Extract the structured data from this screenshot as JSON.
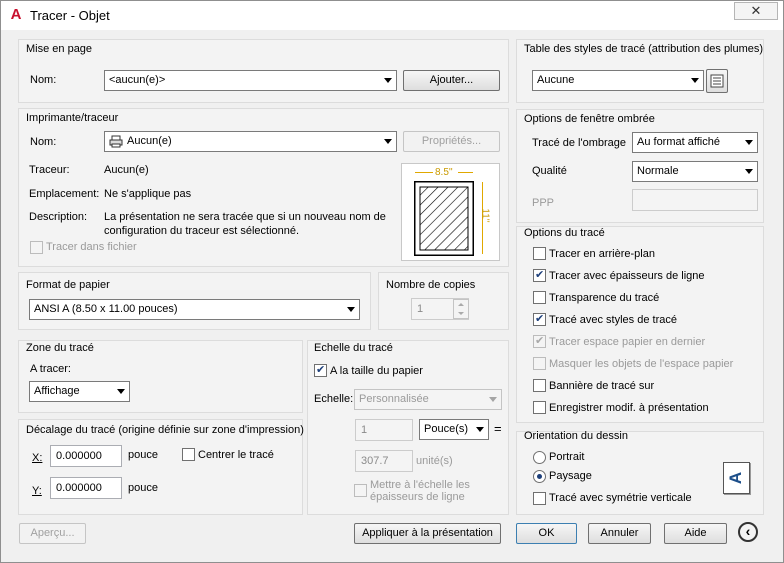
{
  "window": {
    "title": "Tracer - Objet",
    "close": "✕"
  },
  "page_setup": {
    "label": "Mise en page",
    "name_label": "Nom:",
    "name_value": "<aucun(e)>",
    "add_button": "Ajouter..."
  },
  "printer": {
    "label": "Imprimante/traceur",
    "name_label": "Nom:",
    "name_value": "Aucun(e)",
    "properties_button": "Propriétés...",
    "plotter_label": "Traceur:",
    "plotter_value": "Aucun(e)",
    "location_label": "Emplacement:",
    "location_value": "Ne s'applique pas",
    "description_label": "Description:",
    "description_line1": "La présentation ne sera tracée que si un nouveau nom de",
    "description_line2": "configuration du traceur est sélectionné.",
    "plot_to_file": "Tracer dans fichier",
    "preview_width": "8.5''",
    "preview_height": "11''"
  },
  "paper": {
    "label": "Format de papier",
    "value": "ANSI A (8.50 x 11.00 pouces)"
  },
  "copies": {
    "label": "Nombre de copies",
    "value": "1"
  },
  "plot_area": {
    "label": "Zone du tracé",
    "what_label": "A tracer:",
    "what_value": "Affichage"
  },
  "offset": {
    "label": "Décalage du tracé (origine définie sur zone d'impression)",
    "x_label": "X:",
    "x_value": "0.000000",
    "x_unit": "pouce",
    "center_label": "Centrer le tracé",
    "y_label": "Y:",
    "y_value": "0.000000",
    "y_unit": "pouce"
  },
  "scale": {
    "label": "Echelle du tracé",
    "fit_label": "A la taille du papier",
    "scale_label": "Echelle:",
    "scale_value": "Personnalisée",
    "value1": "1",
    "unit_value": "Pouce(s)",
    "equals": "=",
    "value2": "307.7",
    "unit2": "unité(s)",
    "scale_lineweights_line1": "Mettre à l'échelle les",
    "scale_lineweights_line2": "épaisseurs de ligne"
  },
  "style_table": {
    "label": "Table des styles de tracé (attribution des plumes)",
    "value": "Aucune"
  },
  "shaded": {
    "label": "Options de fenêtre ombrée",
    "shade_label": "Tracé de l'ombrage",
    "shade_value": "Au format affiché",
    "quality_label": "Qualité",
    "quality_value": "Normale",
    "dpi_label": "PPP"
  },
  "options": {
    "label": "Options du tracé",
    "items": [
      {
        "label": "Tracer en arrière-plan",
        "checked": false,
        "disabled": false
      },
      {
        "label": "Tracer avec épaisseurs de ligne",
        "checked": true,
        "disabled": false
      },
      {
        "label": "Transparence du tracé",
        "checked": false,
        "disabled": false
      },
      {
        "label": "Tracé avec styles de tracé",
        "checked": true,
        "disabled": false
      },
      {
        "label": "Tracer espace papier en dernier",
        "checked": true,
        "disabled": true
      },
      {
        "label": "Masquer les objets de l'espace papier",
        "checked": false,
        "disabled": true
      },
      {
        "label": "Bannière de tracé sur",
        "checked": false,
        "disabled": false
      },
      {
        "label": "Enregistrer modif. à présentation",
        "checked": false,
        "disabled": false
      }
    ]
  },
  "orientation": {
    "label": "Orientation du dessin",
    "portrait": "Portrait",
    "landscape": "Paysage",
    "upside_down": "Tracé avec symétrie verticale",
    "icon_letter": "A"
  },
  "footer": {
    "preview": "Aperçu...",
    "apply": "Appliquer à la présentation",
    "ok": "OK",
    "cancel": "Annuler",
    "help": "Aide",
    "more": "‹"
  }
}
